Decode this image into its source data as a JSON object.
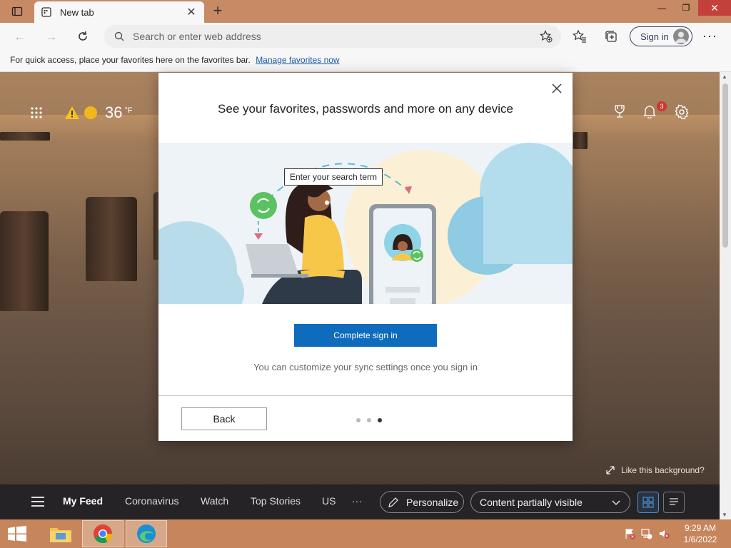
{
  "browser": {
    "tab_title": "New tab",
    "address_placeholder": "Search or enter web address",
    "signin_label": "Sign in"
  },
  "favorites_bar": {
    "message": "For quick access, place your favorites here on the favorites bar.",
    "link": "Manage favorites now"
  },
  "weather": {
    "temperature": "36",
    "unit": "°F"
  },
  "notifications": {
    "count": "3"
  },
  "background": {
    "like_label": "Like this background?"
  },
  "feed": {
    "items": [
      "My Feed",
      "Coronavirus",
      "Watch",
      "Top Stories",
      "US"
    ],
    "more": "···",
    "personalize": "Personalize",
    "visibility": "Content partially visible"
  },
  "modal": {
    "title": "See your favorites, passwords and more on any device",
    "tooltip": "Enter your search term",
    "primary_button": "Complete sign in",
    "hint": "You can customize your sync settings once you sign in",
    "back_button": "Back",
    "pager": {
      "total": 3,
      "current": 3
    }
  },
  "taskbar": {
    "time": "9:29 AM",
    "date": "1/6/2022"
  },
  "colors": {
    "accent": "#0f6cbd",
    "taskbar": "#c7855c",
    "titlebar": "#c88a64",
    "badge": "#d13438"
  }
}
